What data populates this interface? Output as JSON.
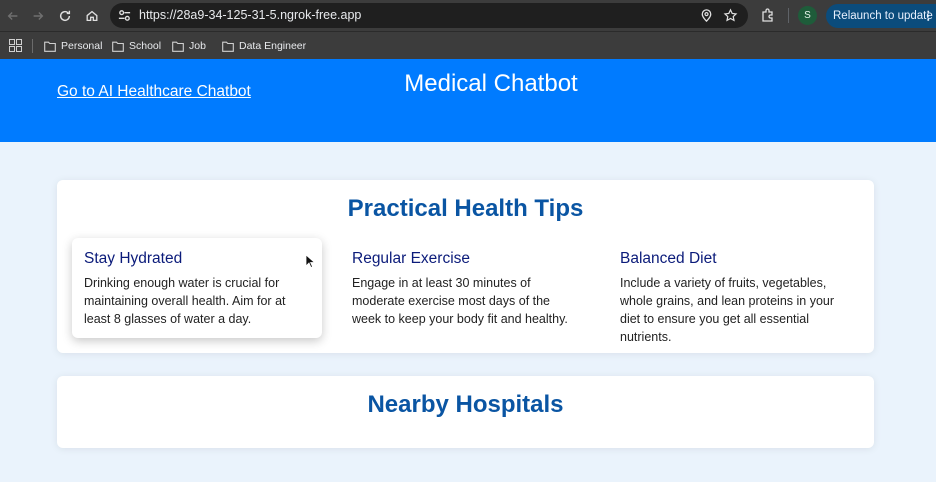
{
  "browser": {
    "url": "https://28a9-34-125-31-5.ngrok-free.app",
    "avatar_letter": "S",
    "relaunch_label": "Relaunch to update",
    "bookmarks": [
      "Personal",
      "School",
      "Job",
      "Data Engineer"
    ]
  },
  "header": {
    "link_label": "Go to AI Healthcare Chatbot",
    "title": "Medical Chatbot",
    "bg_color": "#007bff"
  },
  "tips_section": {
    "title": "Practical Health Tips",
    "tips": [
      {
        "heading": "Stay Hydrated",
        "body": "Drinking enough water is crucial for maintaining overall health. Aim for at least 8 glasses of water a day."
      },
      {
        "heading": "Regular Exercise",
        "body": "Engage in at least 30 minutes of moderate exercise most days of the week to keep your body fit and healthy."
      },
      {
        "heading": "Balanced Diet",
        "body": "Include a variety of fruits, vegetables, whole grains, and lean proteins in your diet to ensure you get all essential nutrients."
      }
    ]
  },
  "hospitals_section": {
    "title": "Nearby Hospitals"
  },
  "colors": {
    "page_bg": "#eaf3fc",
    "section_title": "#0a55a3",
    "tip_heading": "#0b1b7a"
  }
}
